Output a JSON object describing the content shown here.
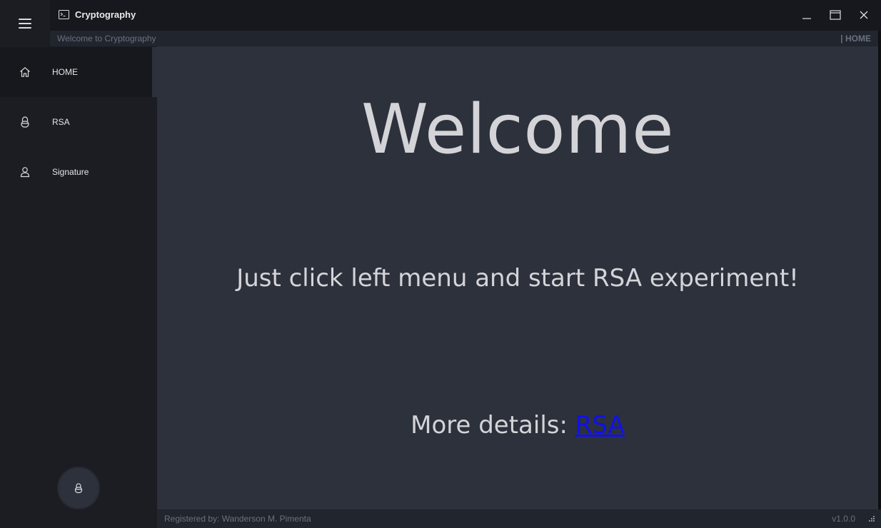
{
  "window": {
    "title": "Cryptography",
    "subtitle": "Welcome to Cryptography",
    "current_page": "| HOME"
  },
  "menu": {
    "items": [
      {
        "label": "HOME",
        "icon": "home-icon",
        "active": true
      },
      {
        "label": "RSA",
        "icon": "lock-icon",
        "active": false
      },
      {
        "label": "Signature",
        "icon": "user-icon",
        "active": false
      }
    ]
  },
  "content": {
    "heading": "Welcome",
    "instruction": "Just click left menu and start RSA experiment!",
    "details_prefix": "More details: ",
    "details_link": "RSA"
  },
  "footer": {
    "credits": "Registered by: Wanderson M. Pimenta",
    "version": "v1.0.0"
  },
  "colors": {
    "menu_bg": "#1b1d23",
    "content_bg": "#2c313c",
    "bar_bg": "#21252d",
    "link": "#1010ee"
  }
}
